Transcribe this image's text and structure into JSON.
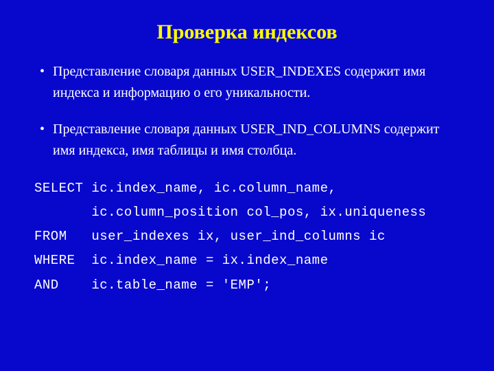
{
  "title": "Проверка индексов",
  "bullets": [
    "Представление словаря данных USER_INDEXES содержит имя индекса и информацию о его уникальности.",
    "Представление словаря данных USER_IND_COLUMNS содержит имя индекса, имя таблицы и имя столбца."
  ],
  "code": {
    "line1": "SELECT ic.index_name, ic.column_name,",
    "line2": "       ic.column_position col_pos, ix.uniqueness",
    "line3": "FROM   user_indexes ix, user_ind_columns ic",
    "line4": "WHERE  ic.index_name = ix.index_name",
    "line5": "AND    ic.table_name = 'EMP';"
  }
}
